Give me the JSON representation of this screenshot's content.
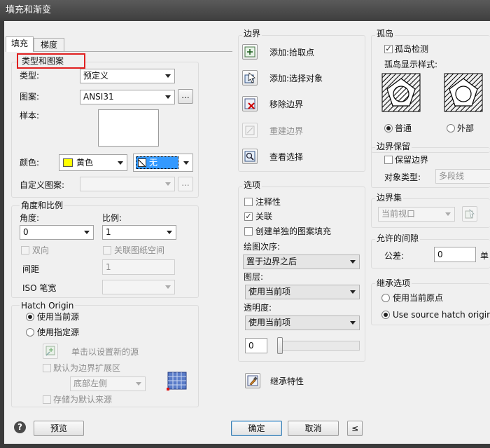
{
  "window": {
    "title": "填充和渐变"
  },
  "tabs": [
    {
      "label": "填充"
    },
    {
      "label": "梯度"
    }
  ],
  "type_pattern": {
    "section_title": "类型和图案",
    "type_label": "类型:",
    "type_value": "预定义",
    "pattern_label": "图案:",
    "pattern_value": "ANSI31",
    "ellipsis": "...",
    "swatch_label": "样本:",
    "color_label": "颜色:",
    "color_value": "黄色",
    "color_swatch": "#ffff00",
    "bg_color_value": "无",
    "custom_label": "自定义图案:",
    "custom_ellipsis": "..."
  },
  "angle_scale": {
    "section_title": "角度和比例",
    "angle_label": "角度:",
    "angle_value": "0",
    "scale_label": "比例:",
    "scale_value": "1",
    "double_label": "双向",
    "relative_label": "关联图纸空间",
    "spacing_label": "间距",
    "spacing_value": "1",
    "iso_label": "ISO 笔宽"
  },
  "origin": {
    "section_title": "Hatch Origin",
    "use_current": "使用当前源",
    "use_specified": "使用指定源",
    "click_set": "单击以设置新的源",
    "default_extent": "默认为边界扩展区",
    "position_value": "底部左侧",
    "store_default": "存储为默认来源"
  },
  "boundaries": {
    "section_title": "边界",
    "add_pick": "添加:拾取点",
    "add_select": "添加:选择对象",
    "remove": "移除边界",
    "recreate": "重建边界",
    "view": "查看选择"
  },
  "options": {
    "section_title": "选项",
    "annotative": "注释性",
    "associative": "关联",
    "separate": "创建单独的图案填充",
    "draw_order_label": "绘图次序:",
    "draw_order_value": "置于边界之后",
    "layer_label": "图层:",
    "layer_value": "使用当前项",
    "transparency_label": "透明度:",
    "transparency_value": "使用当前项",
    "transparency_number": "0",
    "transparency_fraction": 0
  },
  "inherit": {
    "label": "继承特性"
  },
  "islands": {
    "section_title": "孤岛",
    "detect": "孤岛检测",
    "style_label": "孤岛显示样式:",
    "normal": "普通",
    "outer": "外部"
  },
  "retain": {
    "section_title": "边界保留",
    "retain_label": "保留边界",
    "object_type_label": "对象类型:",
    "object_type_value": "多段线"
  },
  "boundary_set": {
    "section_title": "边界集",
    "value": "当前视口"
  },
  "gap": {
    "section_title": "允许的间隙",
    "tolerance_label": "公差:",
    "tolerance_value": "0",
    "unit_label": "单"
  },
  "inherit_options": {
    "section_title": "继承选项",
    "use_current": "使用当前原点",
    "use_source": "Use source hatch origin"
  },
  "footer": {
    "help": "?",
    "preview": "预览",
    "ok": "确定",
    "cancel": "取消",
    "more": "≤"
  }
}
